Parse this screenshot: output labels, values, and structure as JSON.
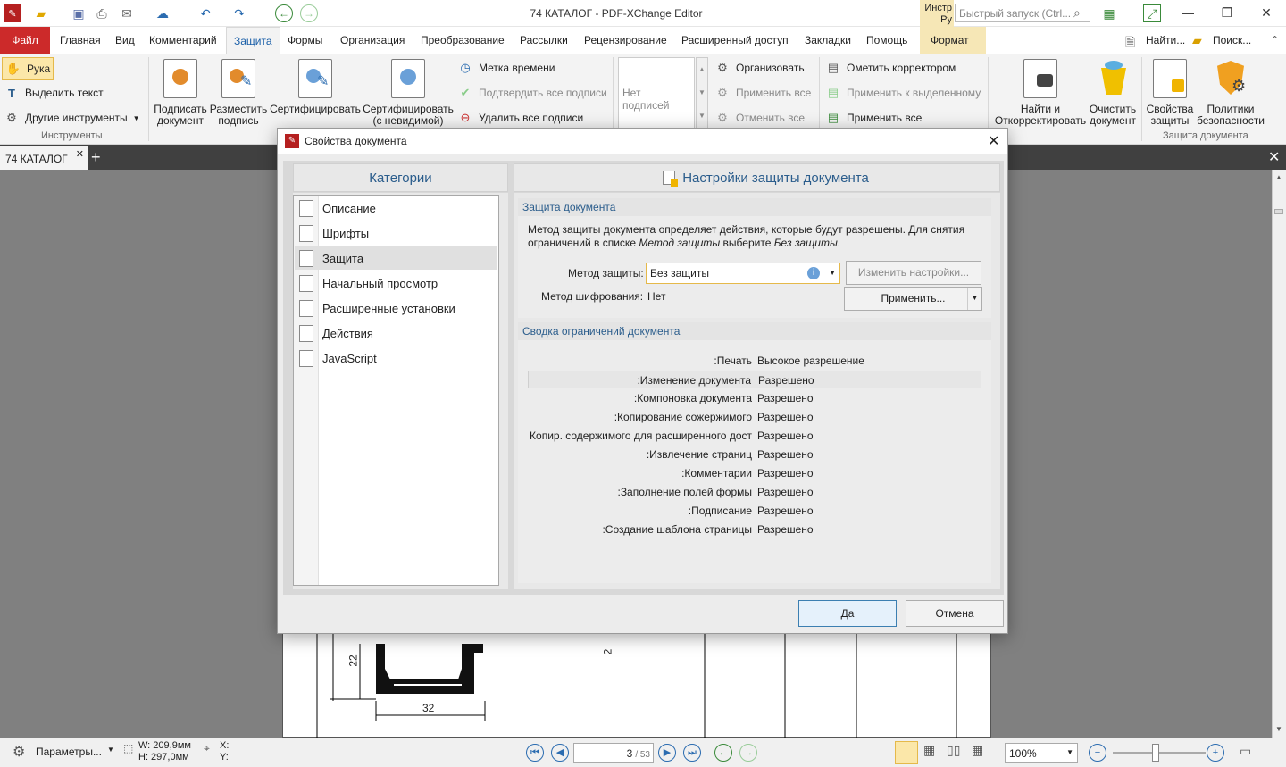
{
  "window": {
    "title": "74 КАТАЛОГ - PDF-XChange Editor",
    "quick_launch_placeholder": "Быстрый запуск (Ctrl...",
    "tools_cut": "Инстр",
    "tools_cut2": "Ру"
  },
  "menu": {
    "file": "Файл",
    "tabs": [
      "Главная",
      "Вид",
      "Комментарий",
      "Защита",
      "Формы",
      "Организация",
      "Преобразование",
      "Рассылки",
      "Рецензирование",
      "Расширенный доступ",
      "Закладки",
      "Помощь"
    ],
    "context": "Формат",
    "find": "Найти...",
    "search": "Поиск..."
  },
  "ribbon": {
    "tools": {
      "hand": "Рука",
      "select_text": "Выделить текст",
      "other_tools": "Другие инструменты",
      "group": "Инструменты"
    },
    "sign": {
      "sign_doc": [
        "Подписать",
        "документ"
      ],
      "place_sig": [
        "Разместить",
        "подпись"
      ],
      "certify": [
        "Сертифицировать",
        ""
      ],
      "certify_invisible": [
        "Сертифицировать",
        "(с невидимой)"
      ]
    },
    "sig_small": {
      "timestamp": "Метка времени",
      "validate_all": "Подтвердить все подписи",
      "delete_all": "Удалить все подписи"
    },
    "sig_list": "Нет подписей",
    "redact": {
      "organize": "Организовать",
      "apply_all": "Применить все",
      "cancel_all": "Отменить все",
      "mark": "Ометить корректором",
      "apply_selected": "Применить к выделенному",
      "apply_all2": "Применить все"
    },
    "security": {
      "find_redact": [
        "Найти и",
        "Откорректировать"
      ],
      "sanitize": [
        "Очистить",
        "документ"
      ],
      "sec_props": [
        "Свойства",
        "защиты"
      ],
      "policies": [
        "Политики",
        "безопасности"
      ],
      "group": "Защита документа"
    }
  },
  "doc_tab": {
    "label": "74 КАТАЛОГ"
  },
  "drawing": {
    "dim1": "22",
    "dim2": "32",
    "dim3": "2"
  },
  "dialog": {
    "title": "Свойства документа",
    "categories_header": "Категории",
    "categories": [
      {
        "label": "Описание"
      },
      {
        "label": "Шрифты"
      },
      {
        "label": "Защита"
      },
      {
        "label": "Начальный просмотр"
      },
      {
        "label": "Расширенные установки"
      },
      {
        "label": "Действия"
      },
      {
        "label": "JavaScript"
      }
    ],
    "selected_category": "Защита",
    "right_header": "Настройки защиты документа",
    "protection_section": "Защита документа",
    "desc_line1": "Метод защиты документа определяет действия, которые будут разрешены. Для снятия",
    "desc_line2_a": "ограничений в списке ",
    "desc_line2_b": "Метод защиты",
    "desc_line2_c": " выберите ",
    "desc_line2_d": "Без защиты",
    "desc_line2_e": ".",
    "method_label": "Метод защиты:",
    "method_value": "Без защиты",
    "change_settings": "Изменить настройки...",
    "encryption_label": "Метод шифрования:",
    "encryption_value": "Нет",
    "apply": "Применить...",
    "summary_section": "Сводка ограничений документа",
    "restrictions": [
      {
        "key": "Печать:",
        "value": "Высокое разрешение"
      },
      {
        "key": "Изменение документа:",
        "value": "Разрешено"
      },
      {
        "key": "Компоновка документа:",
        "value": "Разрешено"
      },
      {
        "key": "Копирование сожержимого:",
        "value": "Разрешено"
      },
      {
        "key": "Копир. содержимого для расширенного дост",
        "value": "Разрешено"
      },
      {
        "key": "Извлечение страниц:",
        "value": "Разрешено"
      },
      {
        "key": "Комментарии:",
        "value": "Разрешено"
      },
      {
        "key": "Заполнение полей формы:",
        "value": "Разрешено"
      },
      {
        "key": "Подписание:",
        "value": "Разрешено"
      },
      {
        "key": "Создание шаблона страницы:",
        "value": "Разрешено"
      }
    ],
    "ok": "Да",
    "cancel": "Отмена"
  },
  "status": {
    "options": "Параметры...",
    "w": "W: 209,9мм",
    "h": "H: 297,0мм",
    "x": "X:",
    "y": "Y:",
    "page": "3",
    "pages": "/ 53",
    "zoom": "100%"
  },
  "colors": {
    "accent": "#1a5fa8",
    "file_tab": "#cc2a2a",
    "context_tab": "#f6e7b6"
  }
}
